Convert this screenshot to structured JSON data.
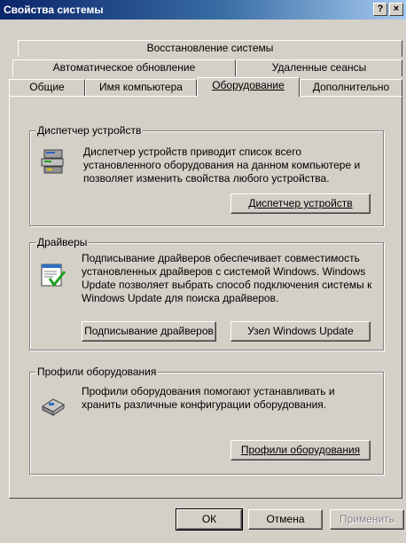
{
  "window": {
    "title": "Свойства системы",
    "help_label": "?",
    "close_label": "×"
  },
  "tabs": {
    "row1": [
      "Восстановление системы"
    ],
    "row2": [
      "Автоматическое обновление",
      "Удаленные сеансы"
    ],
    "row3": [
      "Общие",
      "Имя компьютера",
      "Оборудование",
      "Дополнительно"
    ],
    "active": "Оборудование"
  },
  "device_manager": {
    "legend": "Диспетчер устройств",
    "description": "Диспетчер устройств приводит список всего установленного оборудования на данном компьютере и позволяет изменить свойства любого устройства.",
    "button": "Диспетчер устройств"
  },
  "drivers": {
    "legend": "Драйверы",
    "description": "Подписывание драйверов обеспечивает совместимость установленных драйверов с системой Windows.  Windows Update позволяет выбрать способ подключения системы к Windows Update для поиска драйверов.",
    "signing_button": "Подписывание драйверов",
    "update_button": "Узел Windows Update"
  },
  "hardware_profiles": {
    "legend": "Профили оборудования",
    "description": "Профили оборудования помогают устанавливать и хранить различные конфигурации оборудования.",
    "button": "Профили оборудования"
  },
  "footer": {
    "ok": "ОК",
    "cancel": "Отмена",
    "apply": "Применить"
  }
}
